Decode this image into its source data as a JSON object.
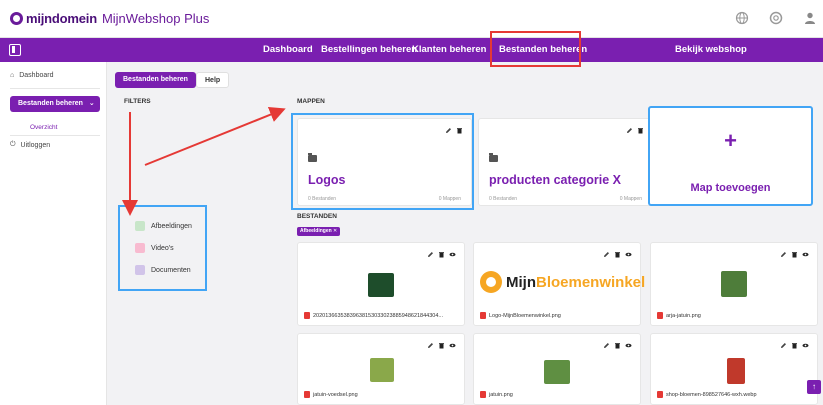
{
  "header": {
    "brand_name": "mijndomein",
    "product_name": "MijnWebshop Plus"
  },
  "nav": {
    "items": [
      "Dashboard",
      "Bestellingen beheren",
      "Klanten beheren",
      "Bestanden beheren",
      "Bekijk webshop"
    ],
    "active": "Bestanden beheren"
  },
  "sidebar": {
    "dashboard": "Dashboard",
    "active_section": "Bestanden beheren",
    "sub_item": "Overzicht",
    "logout": "Uitloggen"
  },
  "tabs": [
    "Bestanden beheren",
    "Help"
  ],
  "filters": {
    "title": "FILTERS",
    "items": [
      "Afbeeldingen",
      "Video's",
      "Documenten"
    ]
  },
  "folders": {
    "title": "MAPPEN",
    "items": [
      {
        "name": "Logos",
        "files": "0 Bestanden",
        "maps": "0 Mappen"
      },
      {
        "name": "producten categorie X",
        "files": "0 Bestanden",
        "maps": "0 Mappen"
      }
    ],
    "add_label": "Map toevoegen",
    "add_symbol": "+"
  },
  "files": {
    "title": "BESTANDEN",
    "badge": "Afbeeldingen ✕",
    "items": [
      {
        "name": "20201366353839638153033023885948621844304..."
      },
      {
        "name": "Logo-MijnBloemenwinkel.png"
      },
      {
        "name": "arja-jatuin.png"
      },
      {
        "name": "jatuin-voedsel.png"
      },
      {
        "name": "jatuin.png"
      },
      {
        "name": "shop-bloemen-898527646-wxh.webp"
      }
    ],
    "logo_text_a": "Mijn",
    "logo_text_b": "Bloemenwinkel"
  },
  "colors": {
    "brand": "#7a1fb0",
    "highlight_red": "#e53935",
    "highlight_blue": "#42a5f5"
  },
  "icons": {
    "edit": "pencil-icon",
    "delete": "trash-icon",
    "view": "eye-icon",
    "folder": "folder-icon"
  }
}
